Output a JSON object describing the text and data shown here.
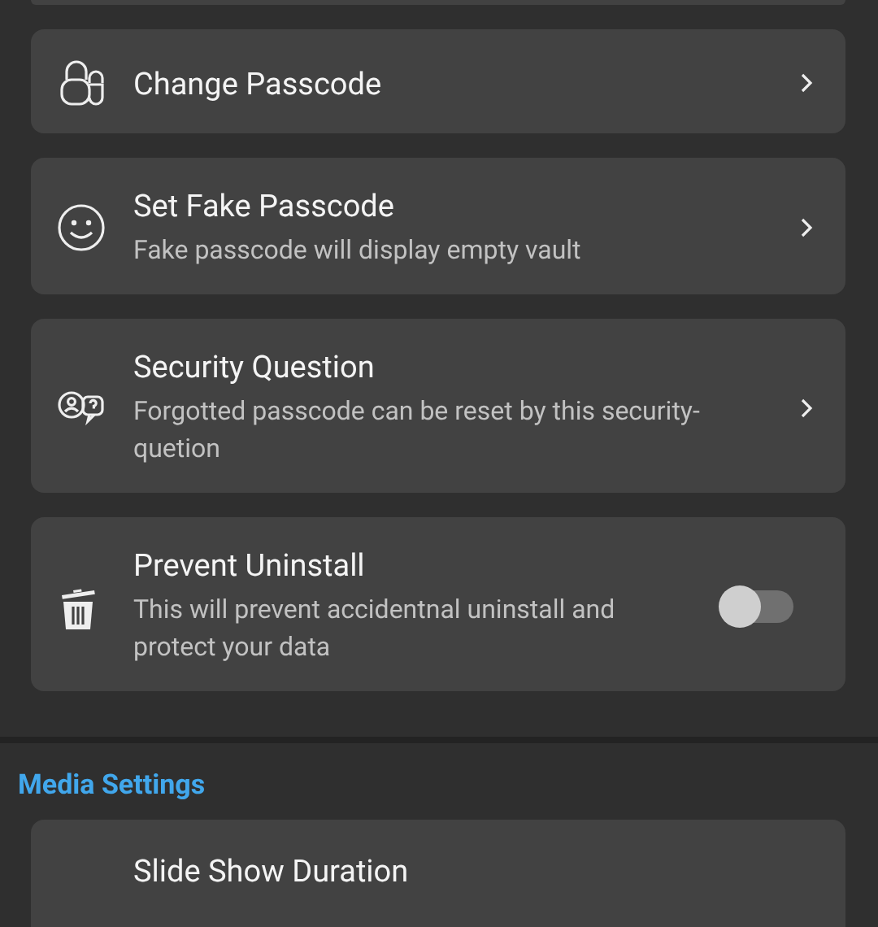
{
  "sections": [
    {
      "items": [
        {
          "kind": "link",
          "title": "Change Passcode"
        },
        {
          "kind": "link",
          "title": "Set Fake Passcode",
          "subtitle": "Fake passcode will display empty vault"
        },
        {
          "kind": "link",
          "title": "Security Question",
          "subtitle": "Forgotted passcode can be reset by this security-quetion"
        },
        {
          "kind": "toggle",
          "title": "Prevent Uninstall",
          "subtitle": "This will prevent accidentnal uninstall and protect your data",
          "on": false
        }
      ]
    },
    {
      "heading": "Media Settings",
      "items": [
        {
          "kind": "cut",
          "title": "Slide Show Duration"
        }
      ]
    }
  ]
}
